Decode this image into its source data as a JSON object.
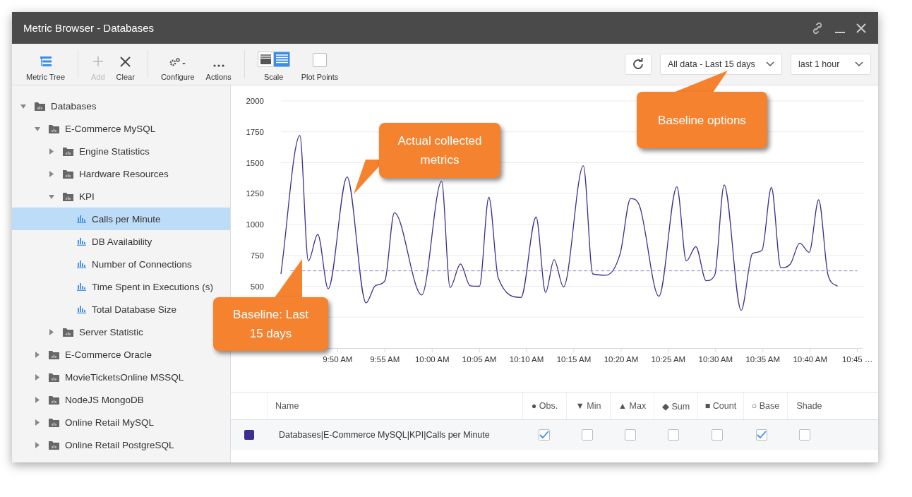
{
  "window": {
    "title": "Metric Browser - Databases"
  },
  "toolbar": [
    {
      "kind": "tree",
      "label": "Metric Tree",
      "disabled": false
    },
    {
      "kind": "add",
      "label": "Add",
      "disabled": true
    },
    {
      "kind": "clear",
      "label": "Clear",
      "disabled": false
    },
    {
      "kind": "configure",
      "label": "Configure",
      "disabled": false
    },
    {
      "kind": "actions",
      "label": "Actions",
      "disabled": false
    },
    {
      "kind": "scale",
      "label": "Scale",
      "disabled": false
    },
    {
      "kind": "plot-points",
      "label": "Plot Points",
      "disabled": false,
      "checked": false
    }
  ],
  "baseline_dropdown": {
    "value": "All data - Last 15 days"
  },
  "range_dropdown": {
    "value": "last 1 hour"
  },
  "tree": [
    {
      "kind": "folder",
      "label": "Databases",
      "expanded": true,
      "selected": false,
      "children": [
        {
          "kind": "folder",
          "label": "E-Commerce MySQL",
          "expanded": true,
          "selected": false,
          "children": [
            {
              "kind": "folder",
              "label": "Engine Statistics",
              "expanded": false,
              "selected": false
            },
            {
              "kind": "folder",
              "label": "Hardware Resources",
              "expanded": false,
              "selected": false
            },
            {
              "kind": "folder",
              "label": "KPI",
              "expanded": true,
              "selected": false,
              "children": [
                {
                  "kind": "metric",
                  "label": "Calls per Minute",
                  "selected": true
                },
                {
                  "kind": "metric",
                  "label": "DB Availability",
                  "selected": false
                },
                {
                  "kind": "metric",
                  "label": "Number of Connections",
                  "selected": false
                },
                {
                  "kind": "metric",
                  "label": "Time Spent in Executions (s)",
                  "selected": false
                },
                {
                  "kind": "metric",
                  "label": "Total Database Size",
                  "selected": false
                }
              ]
            },
            {
              "kind": "folder",
              "label": "Server Statistic",
              "expanded": false,
              "selected": false
            }
          ]
        },
        {
          "kind": "folder",
          "label": "E-Commerce Oracle",
          "expanded": false,
          "selected": false
        },
        {
          "kind": "folder",
          "label": "MovieTicketsOnline MSSQL",
          "expanded": false,
          "selected": false
        },
        {
          "kind": "folder",
          "label": "NodeJS MongoDB",
          "expanded": false,
          "selected": false
        },
        {
          "kind": "folder",
          "label": "Online Retail MySQL",
          "expanded": false,
          "selected": false
        },
        {
          "kind": "folder",
          "label": "Online Retail PostgreSQL",
          "expanded": false,
          "selected": false
        }
      ]
    }
  ],
  "chart_data": {
    "type": "line",
    "grid": true,
    "xlim": [
      584,
      645.4
    ],
    "ylim": [
      0,
      2000
    ],
    "yticks": [
      500,
      750,
      1000,
      1250,
      1500,
      1750,
      2000
    ],
    "xticks": [
      {
        "value": 590,
        "label": "9:50 AM"
      },
      {
        "value": 595,
        "label": "9:55 AM"
      },
      {
        "value": 600,
        "label": "10:00 AM"
      },
      {
        "value": 605,
        "label": "10:05 AM"
      },
      {
        "value": 610,
        "label": "10:10 AM"
      },
      {
        "value": 615,
        "label": "10:15 AM"
      },
      {
        "value": 620,
        "label": "10:20 AM"
      },
      {
        "value": 625,
        "label": "10:25 AM"
      },
      {
        "value": 630,
        "label": "10:30 AM"
      },
      {
        "value": 635,
        "label": "10:35 AM"
      },
      {
        "value": 640,
        "label": "10:40 AM"
      },
      {
        "value": 645,
        "label": "10:45 …"
      }
    ],
    "series": [
      {
        "color": "#3c2f8f",
        "x": [
          584.0,
          586.0,
          586.9,
          587.9,
          589.0,
          591.0,
          593.0,
          594.0,
          595.0,
          596.0,
          598.9,
          601.0,
          601.9,
          603.0,
          604.0,
          605.0,
          606.0,
          607.0,
          609.4,
          611.0,
          612.0,
          612.9,
          613.9,
          616.0,
          617.0,
          618.4,
          619.9,
          621.0,
          621.9,
          624.0,
          625.9,
          626.9,
          627.9,
          629.0,
          629.9,
          630.9,
          632.7,
          633.9,
          634.9,
          635.9,
          636.9,
          637.9,
          638.9,
          639.9,
          640.9,
          641.9,
          642.9
        ],
        "values": [
          600,
          1720,
          705,
          920,
          480,
          1385,
          365,
          505,
          545,
          1095,
          430,
          1350,
          490,
          680,
          505,
          500,
          1220,
          565,
          410,
          1060,
          450,
          715,
          495,
          1475,
          600,
          590,
          765,
          1210,
          1160,
          420,
          1305,
          705,
          820,
          545,
          590,
          1320,
          305,
          765,
          790,
          1300,
          650,
          680,
          850,
          775,
          1200,
          590,
          500
        ]
      },
      {
        "color": "#8a84c4",
        "line_style": "dashed",
        "x": [
          585,
          645
        ],
        "values": [
          625,
          625
        ]
      }
    ]
  },
  "callouts": [
    {
      "text": "Actual collected metrics"
    },
    {
      "text": "Baseline options"
    },
    {
      "text": "Baseline: Last 15 days"
    }
  ],
  "table": {
    "columns": [
      "Name",
      "● Obs.",
      "▼ Min",
      "▲ Max",
      "◆ Sum",
      "■ Count",
      "○ Base",
      "Shade"
    ],
    "rows": [
      {
        "color": "#3c2f8f",
        "name": "Databases|E-Commerce MySQL|KPI|Calls per Minute",
        "checks": [
          true,
          false,
          false,
          false,
          false,
          true,
          false
        ]
      }
    ]
  }
}
